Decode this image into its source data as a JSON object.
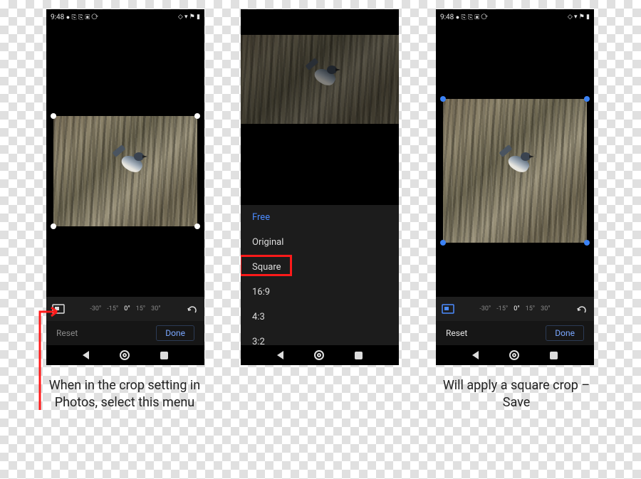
{
  "status": {
    "time": "9:48",
    "left_icons": "● ⎘ ⎘ ▣ ⟳",
    "right_icons": "◇ ▾ ⚑ ▮"
  },
  "toolbar": {
    "degrees": [
      "-30°",
      "-15°",
      "0°",
      "15°",
      "30°"
    ]
  },
  "actions": {
    "reset": "Reset",
    "done": "Done"
  },
  "ratio_menu": {
    "items": [
      "Free",
      "Original",
      "Square",
      "16:9",
      "4:3",
      "3:2"
    ],
    "selected": "Free",
    "highlighted": "Square"
  },
  "captions": {
    "left": "When in the crop setting in Photos, select this menu",
    "right": "Will apply a square crop – Save"
  },
  "colors": {
    "accent_blue": "#4b8bff",
    "highlight_red": "#ff1a1a",
    "handle_blue": "#3b82f6"
  }
}
